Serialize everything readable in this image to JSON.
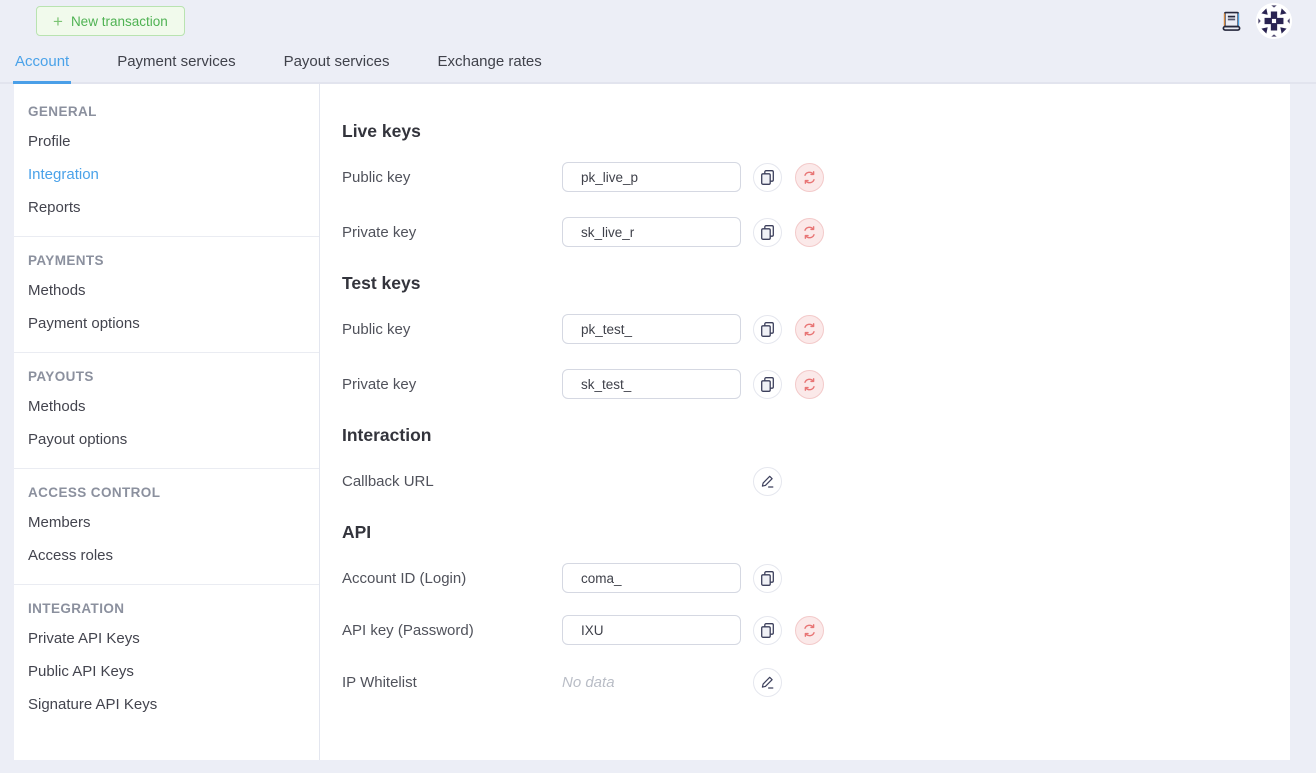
{
  "topbar": {
    "new_transaction": {
      "icon": "+",
      "label": "New transaction"
    },
    "icons": {
      "docs": "docs-book-icon",
      "avatar": "user-avatar-identicon"
    }
  },
  "tabs": {
    "items": [
      {
        "label": "Account",
        "active": true
      },
      {
        "label": "Payment services",
        "active": false
      },
      {
        "label": "Payout services",
        "active": false
      },
      {
        "label": "Exchange rates",
        "active": false
      }
    ]
  },
  "sidebar": {
    "sections": [
      {
        "title": "GENERAL",
        "items": [
          {
            "label": "Profile",
            "active": false
          },
          {
            "label": "Integration",
            "active": true
          },
          {
            "label": "Reports",
            "active": false
          }
        ]
      },
      {
        "title": "PAYMENTS",
        "items": [
          {
            "label": "Methods",
            "active": false
          },
          {
            "label": "Payment options",
            "active": false
          }
        ]
      },
      {
        "title": "PAYOUTS",
        "items": [
          {
            "label": "Methods",
            "active": false
          },
          {
            "label": "Payout options",
            "active": false
          }
        ]
      },
      {
        "title": "ACCESS CONTROL",
        "items": [
          {
            "label": "Members",
            "active": false
          },
          {
            "label": "Access roles",
            "active": false
          }
        ]
      },
      {
        "title": "INTEGRATION",
        "items": [
          {
            "label": "Private API Keys",
            "active": false
          },
          {
            "label": "Public API Keys",
            "active": false
          },
          {
            "label": "Signature API Keys",
            "active": false
          }
        ]
      }
    ]
  },
  "main": {
    "sections": [
      {
        "title": "Live keys",
        "rows": [
          {
            "label": "Public key",
            "value": "pk_live_p",
            "actions": [
              "copy",
              "regenerate"
            ]
          },
          {
            "label": "Private key",
            "value": "sk_live_r",
            "actions": [
              "copy",
              "regenerate"
            ]
          }
        ]
      },
      {
        "title": "Test keys",
        "rows": [
          {
            "label": "Public key",
            "value": "pk_test_",
            "actions": [
              "copy",
              "regenerate"
            ]
          },
          {
            "label": "Private key",
            "value": "sk_test_",
            "actions": [
              "copy",
              "regenerate"
            ]
          }
        ]
      },
      {
        "title": "Interaction",
        "rows": [
          {
            "label": "Callback URL",
            "value": "",
            "actions": [
              "edit"
            ]
          }
        ]
      },
      {
        "title": "API",
        "rows": [
          {
            "label": "Account ID (Login)",
            "value": "coma_",
            "actions": [
              "copy"
            ]
          },
          {
            "label": "API key (Password)",
            "value": "IXU",
            "actions": [
              "copy",
              "regenerate"
            ]
          },
          {
            "label": "IP Whitelist",
            "placeholder": "No data",
            "actions": [
              "edit"
            ]
          }
        ]
      }
    ]
  },
  "colors": {
    "background": "#eceef6",
    "accent_blue": "#4aa2e9",
    "accent_green": "#4fb253",
    "danger_red": "#e87575",
    "panel": "#ffffff"
  }
}
